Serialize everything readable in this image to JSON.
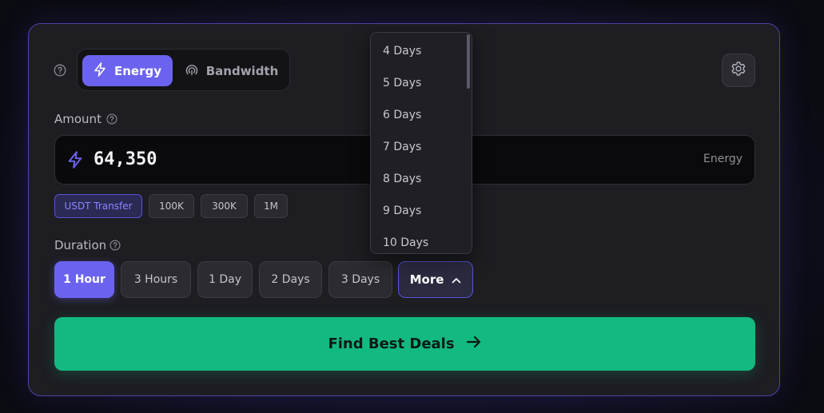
{
  "resource": {
    "tabs": [
      {
        "label": "Energy",
        "icon": "lightning-icon",
        "active": true
      },
      {
        "label": "Bandwidth",
        "icon": "broadcast-icon",
        "active": false
      }
    ]
  },
  "amount": {
    "label": "Amount",
    "value": "64,350",
    "unit": "Energy",
    "presets": [
      "USDT Transfer",
      "100K",
      "300K",
      "1M"
    ]
  },
  "duration": {
    "label": "Duration",
    "options": [
      "1 Hour",
      "3 Hours",
      "1 Day",
      "2 Days",
      "3 Days"
    ],
    "selected": "1 Hour",
    "more_label": "More",
    "dropdown_items": [
      "4 Days",
      "5 Days",
      "6 Days",
      "7 Days",
      "8 Days",
      "9 Days",
      "10 Days"
    ]
  },
  "cta": {
    "label": "Find Best Deals"
  },
  "colors": {
    "accent": "#6b63f0",
    "cta": "#12b981",
    "card_border": "#4b44a8"
  }
}
